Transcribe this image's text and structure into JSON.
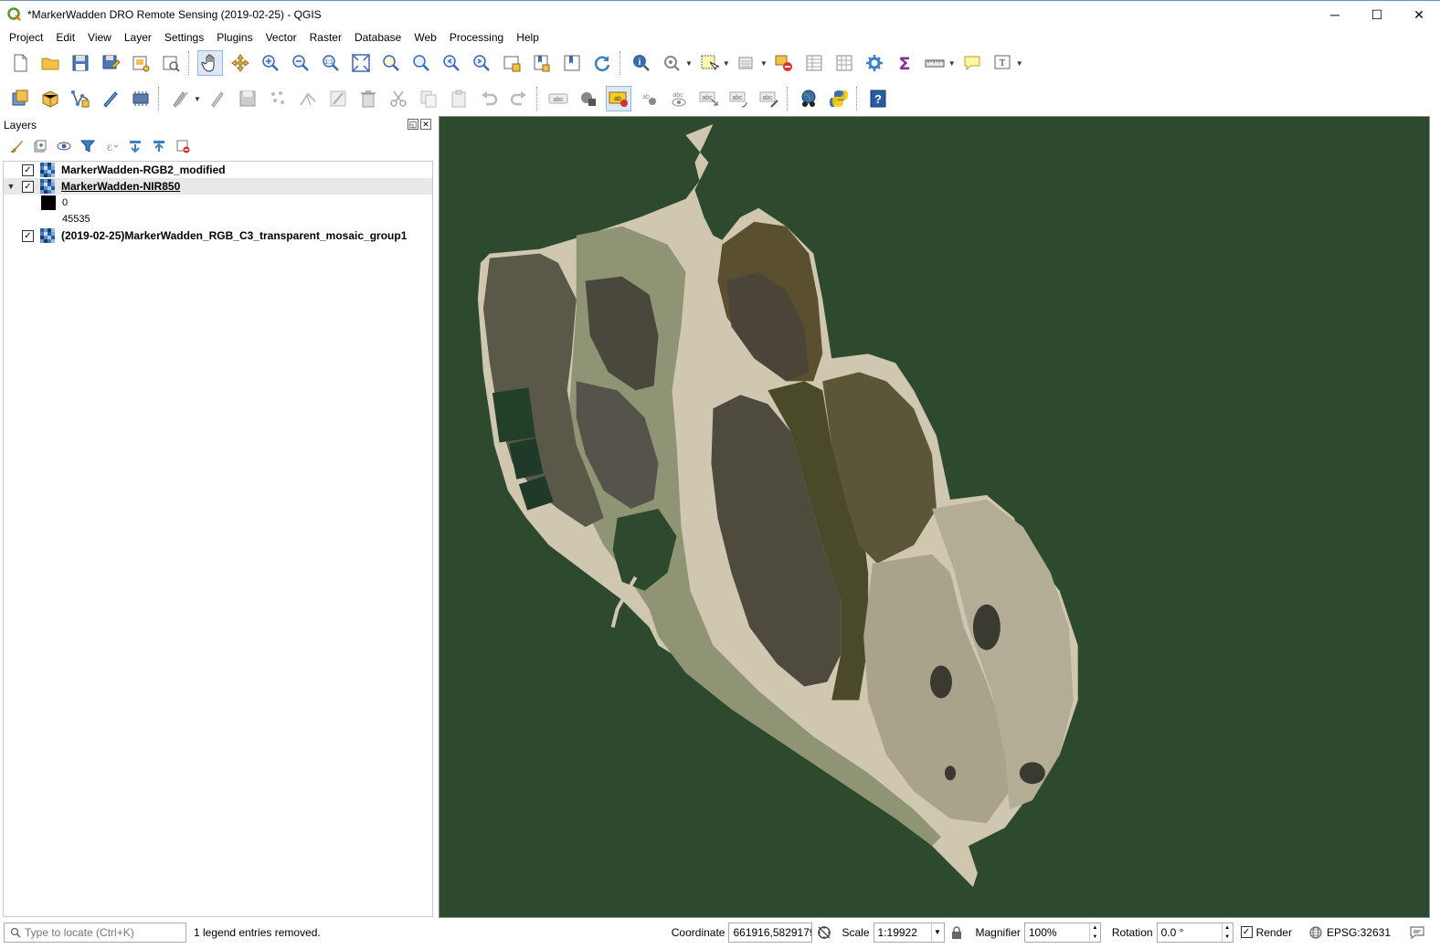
{
  "window": {
    "title": "*MarkerWadden DRO Remote Sensing (2019-02-25) - QGIS",
    "minimize": "─",
    "maximize": "☐",
    "close": "✕"
  },
  "menu": [
    {
      "label": "Project"
    },
    {
      "label": "Edit"
    },
    {
      "label": "View"
    },
    {
      "label": "Layer"
    },
    {
      "label": "Settings"
    },
    {
      "label": "Plugins"
    },
    {
      "label": "Vector"
    },
    {
      "label": "Raster"
    },
    {
      "label": "Database"
    },
    {
      "label": "Web"
    },
    {
      "label": "Processing"
    },
    {
      "label": "Help"
    }
  ],
  "layers_panel": {
    "title": "Layers",
    "float_btn": "◱",
    "close_btn": "✕",
    "layers": [
      {
        "name": "MarkerWadden-RGB2_modified",
        "checked": "✓"
      },
      {
        "name": "MarkerWadden-NIR850",
        "checked": "✓",
        "expander": "▼"
      },
      {
        "name": "(2019-02-25)MarkerWadden_RGB_C3_transparent_mosaic_group1",
        "checked": "✓"
      }
    ],
    "legend": {
      "min": "0",
      "max": "45535"
    }
  },
  "statusbar": {
    "locator_placeholder": "Type to locate (Ctrl+K)",
    "message": "1 legend entries removed.",
    "coordinate_label": "Coordinate",
    "coordinate_value": "661916,5829179",
    "scale_label": "Scale",
    "scale_value": "1:19922",
    "magnifier_label": "Magnifier",
    "magnifier_value": "100%",
    "rotation_label": "Rotation",
    "rotation_value": "0.0 °",
    "render_label": "Render",
    "render_checked": "✓",
    "crs": "EPSG:32631"
  },
  "colors": {
    "water": "#2e4a2e",
    "sand": "#cfc7b0",
    "lagoon": "#8f9474",
    "marsh": "#5a5848"
  }
}
